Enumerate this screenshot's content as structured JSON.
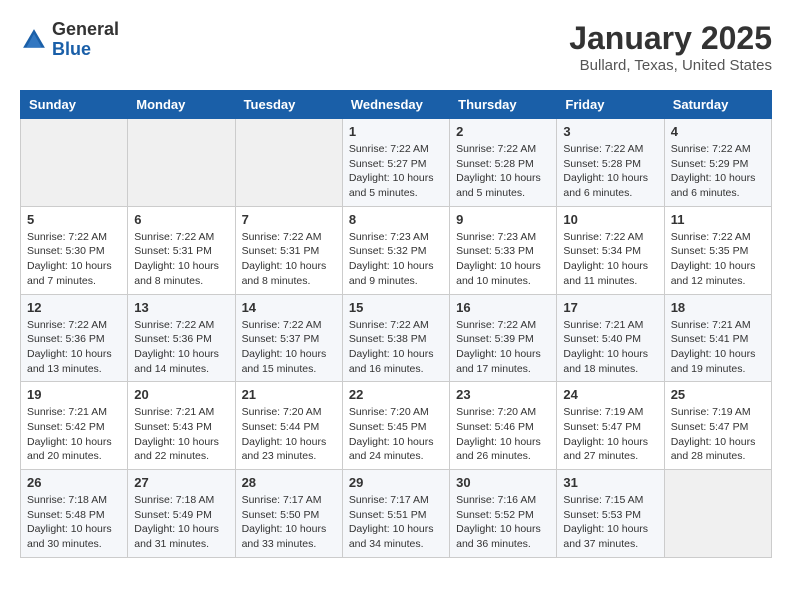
{
  "header": {
    "logo_general": "General",
    "logo_blue": "Blue",
    "title": "January 2025",
    "subtitle": "Bullard, Texas, United States"
  },
  "calendar": {
    "days_of_week": [
      "Sunday",
      "Monday",
      "Tuesday",
      "Wednesday",
      "Thursday",
      "Friday",
      "Saturday"
    ],
    "weeks": [
      [
        {
          "day": "",
          "content": ""
        },
        {
          "day": "",
          "content": ""
        },
        {
          "day": "",
          "content": ""
        },
        {
          "day": "1",
          "content": "Sunrise: 7:22 AM\nSunset: 5:27 PM\nDaylight: 10 hours\nand 5 minutes."
        },
        {
          "day": "2",
          "content": "Sunrise: 7:22 AM\nSunset: 5:28 PM\nDaylight: 10 hours\nand 5 minutes."
        },
        {
          "day": "3",
          "content": "Sunrise: 7:22 AM\nSunset: 5:28 PM\nDaylight: 10 hours\nand 6 minutes."
        },
        {
          "day": "4",
          "content": "Sunrise: 7:22 AM\nSunset: 5:29 PM\nDaylight: 10 hours\nand 6 minutes."
        }
      ],
      [
        {
          "day": "5",
          "content": "Sunrise: 7:22 AM\nSunset: 5:30 PM\nDaylight: 10 hours\nand 7 minutes."
        },
        {
          "day": "6",
          "content": "Sunrise: 7:22 AM\nSunset: 5:31 PM\nDaylight: 10 hours\nand 8 minutes."
        },
        {
          "day": "7",
          "content": "Sunrise: 7:22 AM\nSunset: 5:31 PM\nDaylight: 10 hours\nand 8 minutes."
        },
        {
          "day": "8",
          "content": "Sunrise: 7:23 AM\nSunset: 5:32 PM\nDaylight: 10 hours\nand 9 minutes."
        },
        {
          "day": "9",
          "content": "Sunrise: 7:23 AM\nSunset: 5:33 PM\nDaylight: 10 hours\nand 10 minutes."
        },
        {
          "day": "10",
          "content": "Sunrise: 7:22 AM\nSunset: 5:34 PM\nDaylight: 10 hours\nand 11 minutes."
        },
        {
          "day": "11",
          "content": "Sunrise: 7:22 AM\nSunset: 5:35 PM\nDaylight: 10 hours\nand 12 minutes."
        }
      ],
      [
        {
          "day": "12",
          "content": "Sunrise: 7:22 AM\nSunset: 5:36 PM\nDaylight: 10 hours\nand 13 minutes."
        },
        {
          "day": "13",
          "content": "Sunrise: 7:22 AM\nSunset: 5:36 PM\nDaylight: 10 hours\nand 14 minutes."
        },
        {
          "day": "14",
          "content": "Sunrise: 7:22 AM\nSunset: 5:37 PM\nDaylight: 10 hours\nand 15 minutes."
        },
        {
          "day": "15",
          "content": "Sunrise: 7:22 AM\nSunset: 5:38 PM\nDaylight: 10 hours\nand 16 minutes."
        },
        {
          "day": "16",
          "content": "Sunrise: 7:22 AM\nSunset: 5:39 PM\nDaylight: 10 hours\nand 17 minutes."
        },
        {
          "day": "17",
          "content": "Sunrise: 7:21 AM\nSunset: 5:40 PM\nDaylight: 10 hours\nand 18 minutes."
        },
        {
          "day": "18",
          "content": "Sunrise: 7:21 AM\nSunset: 5:41 PM\nDaylight: 10 hours\nand 19 minutes."
        }
      ],
      [
        {
          "day": "19",
          "content": "Sunrise: 7:21 AM\nSunset: 5:42 PM\nDaylight: 10 hours\nand 20 minutes."
        },
        {
          "day": "20",
          "content": "Sunrise: 7:21 AM\nSunset: 5:43 PM\nDaylight: 10 hours\nand 22 minutes."
        },
        {
          "day": "21",
          "content": "Sunrise: 7:20 AM\nSunset: 5:44 PM\nDaylight: 10 hours\nand 23 minutes."
        },
        {
          "day": "22",
          "content": "Sunrise: 7:20 AM\nSunset: 5:45 PM\nDaylight: 10 hours\nand 24 minutes."
        },
        {
          "day": "23",
          "content": "Sunrise: 7:20 AM\nSunset: 5:46 PM\nDaylight: 10 hours\nand 26 minutes."
        },
        {
          "day": "24",
          "content": "Sunrise: 7:19 AM\nSunset: 5:47 PM\nDaylight: 10 hours\nand 27 minutes."
        },
        {
          "day": "25",
          "content": "Sunrise: 7:19 AM\nSunset: 5:47 PM\nDaylight: 10 hours\nand 28 minutes."
        }
      ],
      [
        {
          "day": "26",
          "content": "Sunrise: 7:18 AM\nSunset: 5:48 PM\nDaylight: 10 hours\nand 30 minutes."
        },
        {
          "day": "27",
          "content": "Sunrise: 7:18 AM\nSunset: 5:49 PM\nDaylight: 10 hours\nand 31 minutes."
        },
        {
          "day": "28",
          "content": "Sunrise: 7:17 AM\nSunset: 5:50 PM\nDaylight: 10 hours\nand 33 minutes."
        },
        {
          "day": "29",
          "content": "Sunrise: 7:17 AM\nSunset: 5:51 PM\nDaylight: 10 hours\nand 34 minutes."
        },
        {
          "day": "30",
          "content": "Sunrise: 7:16 AM\nSunset: 5:52 PM\nDaylight: 10 hours\nand 36 minutes."
        },
        {
          "day": "31",
          "content": "Sunrise: 7:15 AM\nSunset: 5:53 PM\nDaylight: 10 hours\nand 37 minutes."
        },
        {
          "day": "",
          "content": ""
        }
      ]
    ]
  }
}
